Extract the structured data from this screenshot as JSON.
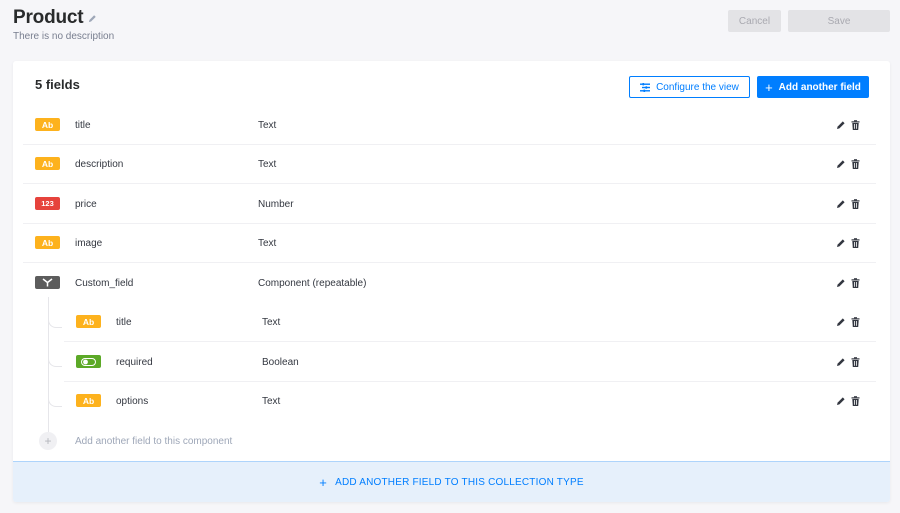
{
  "header": {
    "title": "Product",
    "description": "There is no description",
    "cancel_label": "Cancel",
    "save_label": "Save"
  },
  "card": {
    "fields_count": "5 fields",
    "configure_label": "Configure the view",
    "add_field_label": "Add another field"
  },
  "fields": [
    {
      "badge": "Ab",
      "name": "title",
      "type": "Text"
    },
    {
      "badge": "Ab",
      "name": "description",
      "type": "Text"
    },
    {
      "badge": "123",
      "name": "price",
      "type": "Number"
    },
    {
      "badge": "Ab",
      "name": "image",
      "type": "Text"
    },
    {
      "badge": "",
      "name": "Custom_field",
      "type": "Component (repeatable)"
    }
  ],
  "component_fields": [
    {
      "badge": "Ab",
      "name": "title",
      "type": "Text"
    },
    {
      "badge": "",
      "name": "required",
      "type": "Boolean"
    },
    {
      "badge": "Ab",
      "name": "options",
      "type": "Text"
    }
  ],
  "add_component_field_label": "Add another field to this component",
  "add_collection_field_label": "ADD ANOTHER FIELD TO THIS COLLECTION TYPE",
  "colors": {
    "primary": "#007eff",
    "text_badge": "#fdb21d",
    "number_badge": "#e6433c",
    "component_badge": "#5c5c5c",
    "boolean_badge": "#5ca927"
  },
  "icons": {
    "edit": "pencil-icon",
    "delete": "trash-icon",
    "component": "component-icon",
    "boolean": "toggle-icon",
    "configure": "list-settings-icon"
  }
}
